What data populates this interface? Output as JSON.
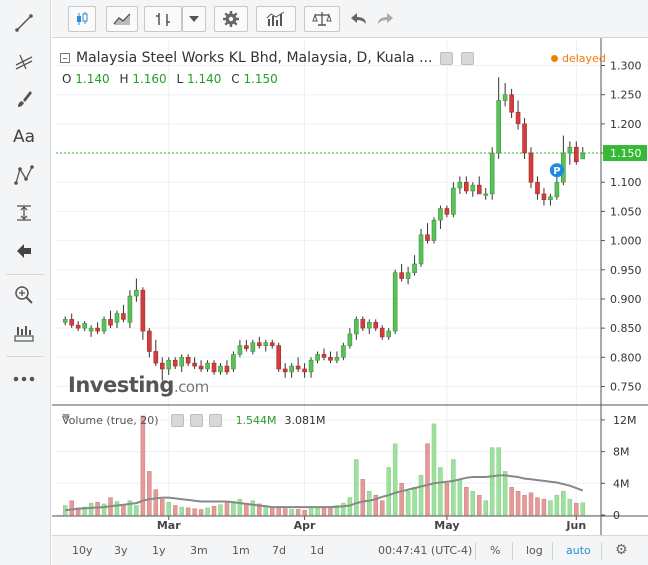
{
  "colors": {
    "up": "#5bbf5b",
    "down": "#d43d3d",
    "vol_up": "#9ee09e",
    "vol_down": "#e59a9a",
    "ma": "#888888",
    "lastline": "#2fb82f",
    "accent": "#2a8fd8"
  },
  "toolbar": {
    "icons": [
      "candlestick-icon",
      "area-chart-icon",
      "bar-chart-icon",
      "dropdown-icon",
      "gear-icon",
      "indicators-icon",
      "compare-scale-icon",
      "undo-icon",
      "redo-icon"
    ]
  },
  "left_tools": [
    "line-tool-icon",
    "fib-tool-icon",
    "brush-icon",
    "text-tool-icon",
    "pattern-tool-icon",
    "measure-icon",
    "back-arrow-icon",
    "zoom-icon",
    "ruler-icon",
    "more-icon"
  ],
  "left_text_label": "Aa",
  "legend": {
    "title": "Malaysia Steel Works KL Bhd, Malaysia, D, Kuala ...",
    "delayed": "delayed",
    "o_label": "O",
    "o": "1.140",
    "h_label": "H",
    "h": "1.160",
    "l_label": "L",
    "l": "1.140",
    "c_label": "C",
    "c": "1.150"
  },
  "volume_legend": {
    "label": "Volume (true, 20)",
    "v1": "1.544M",
    "v2": "3.081M"
  },
  "logo": {
    "main": "Investing",
    "suffix": ".com"
  },
  "price_axis_ticks": [
    "1.300",
    "1.250",
    "1.200",
    "1.150",
    "1.100",
    "1.050",
    "1.000",
    "0.950",
    "0.900",
    "0.850",
    "0.800",
    "0.750"
  ],
  "last_price": "1.150",
  "marker_label": "P",
  "volume_axis_ticks": [
    "12M",
    "8M",
    "4M",
    "0"
  ],
  "x_labels": [
    "Mar",
    "Apr",
    "May",
    "Jun"
  ],
  "bottombar": {
    "ranges": [
      "10y",
      "3y",
      "1y",
      "3m",
      "1m",
      "7d",
      "1d"
    ],
    "time": "00:47:41 (UTC-4)",
    "pct": "%",
    "log": "log",
    "auto": "auto"
  },
  "chart_data": {
    "type": "candlestick",
    "title": "Malaysia Steel Works KL Bhd, Malaysia, D, Kuala ...",
    "price_range": [
      0.72,
      1.33
    ],
    "volume_range": [
      0,
      13000000
    ],
    "x_ticks": [
      {
        "label": "Mar",
        "index": 16
      },
      {
        "label": "Apr",
        "index": 37
      },
      {
        "label": "May",
        "index": 59
      },
      {
        "label": "Jun",
        "index": 79
      }
    ],
    "candles": [
      {
        "o": 0.86,
        "h": 0.87,
        "l": 0.855,
        "c": 0.865,
        "v": 1200000
      },
      {
        "o": 0.865,
        "h": 0.875,
        "l": 0.85,
        "c": 0.855,
        "v": 1800000
      },
      {
        "o": 0.855,
        "h": 0.862,
        "l": 0.845,
        "c": 0.85,
        "v": 900000
      },
      {
        "o": 0.85,
        "h": 0.862,
        "l": 0.845,
        "c": 0.858,
        "v": 1000000
      },
      {
        "o": 0.845,
        "h": 0.855,
        "l": 0.835,
        "c": 0.85,
        "v": 1500000
      },
      {
        "o": 0.85,
        "h": 0.86,
        "l": 0.84,
        "c": 0.845,
        "v": 1600000
      },
      {
        "o": 0.845,
        "h": 0.87,
        "l": 0.84,
        "c": 0.865,
        "v": 1400000
      },
      {
        "o": 0.865,
        "h": 0.88,
        "l": 0.85,
        "c": 0.855,
        "v": 2200000
      },
      {
        "o": 0.86,
        "h": 0.88,
        "l": 0.85,
        "c": 0.875,
        "v": 1700000
      },
      {
        "o": 0.875,
        "h": 0.89,
        "l": 0.86,
        "c": 0.865,
        "v": 1300000
      },
      {
        "o": 0.86,
        "h": 0.915,
        "l": 0.85,
        "c": 0.905,
        "v": 1800000
      },
      {
        "o": 0.905,
        "h": 0.935,
        "l": 0.895,
        "c": 0.915,
        "v": 1200000
      },
      {
        "o": 0.915,
        "h": 0.92,
        "l": 0.83,
        "c": 0.845,
        "v": 12500000
      },
      {
        "o": 0.845,
        "h": 0.85,
        "l": 0.8,
        "c": 0.81,
        "v": 5500000
      },
      {
        "o": 0.81,
        "h": 0.83,
        "l": 0.785,
        "c": 0.79,
        "v": 3200000
      },
      {
        "o": 0.79,
        "h": 0.8,
        "l": 0.76,
        "c": 0.78,
        "v": 2000000
      },
      {
        "o": 0.78,
        "h": 0.8,
        "l": 0.77,
        "c": 0.795,
        "v": 1600000
      },
      {
        "o": 0.795,
        "h": 0.8,
        "l": 0.78,
        "c": 0.785,
        "v": 1200000
      },
      {
        "o": 0.785,
        "h": 0.805,
        "l": 0.775,
        "c": 0.8,
        "v": 1000000
      },
      {
        "o": 0.8,
        "h": 0.805,
        "l": 0.785,
        "c": 0.79,
        "v": 900000
      },
      {
        "o": 0.79,
        "h": 0.8,
        "l": 0.78,
        "c": 0.785,
        "v": 800000
      },
      {
        "o": 0.785,
        "h": 0.795,
        "l": 0.775,
        "c": 0.78,
        "v": 700000
      },
      {
        "o": 0.78,
        "h": 0.795,
        "l": 0.775,
        "c": 0.79,
        "v": 900000
      },
      {
        "o": 0.79,
        "h": 0.795,
        "l": 0.77,
        "c": 0.775,
        "v": 1100000
      },
      {
        "o": 0.775,
        "h": 0.79,
        "l": 0.77,
        "c": 0.785,
        "v": 1300000
      },
      {
        "o": 0.785,
        "h": 0.795,
        "l": 0.77,
        "c": 0.775,
        "v": 1600000
      },
      {
        "o": 0.78,
        "h": 0.81,
        "l": 0.775,
        "c": 0.805,
        "v": 1700000
      },
      {
        "o": 0.805,
        "h": 0.83,
        "l": 0.8,
        "c": 0.82,
        "v": 2000000
      },
      {
        "o": 0.82,
        "h": 0.83,
        "l": 0.81,
        "c": 0.815,
        "v": 1500000
      },
      {
        "o": 0.81,
        "h": 0.83,
        "l": 0.805,
        "c": 0.825,
        "v": 1800000
      },
      {
        "o": 0.825,
        "h": 0.835,
        "l": 0.815,
        "c": 0.82,
        "v": 1400000
      },
      {
        "o": 0.82,
        "h": 0.83,
        "l": 0.81,
        "c": 0.825,
        "v": 1200000
      },
      {
        "o": 0.825,
        "h": 0.83,
        "l": 0.815,
        "c": 0.82,
        "v": 1000000
      },
      {
        "o": 0.82,
        "h": 0.825,
        "l": 0.775,
        "c": 0.78,
        "v": 900000
      },
      {
        "o": 0.78,
        "h": 0.79,
        "l": 0.765,
        "c": 0.775,
        "v": 800000
      },
      {
        "o": 0.775,
        "h": 0.79,
        "l": 0.765,
        "c": 0.785,
        "v": 700000
      },
      {
        "o": 0.785,
        "h": 0.8,
        "l": 0.775,
        "c": 0.78,
        "v": 700000
      },
      {
        "o": 0.78,
        "h": 0.79,
        "l": 0.765,
        "c": 0.775,
        "v": 600000
      },
      {
        "o": 0.775,
        "h": 0.8,
        "l": 0.765,
        "c": 0.795,
        "v": 800000
      },
      {
        "o": 0.795,
        "h": 0.81,
        "l": 0.79,
        "c": 0.805,
        "v": 900000
      },
      {
        "o": 0.805,
        "h": 0.815,
        "l": 0.795,
        "c": 0.8,
        "v": 1000000
      },
      {
        "o": 0.8,
        "h": 0.81,
        "l": 0.79,
        "c": 0.795,
        "v": 1100000
      },
      {
        "o": 0.795,
        "h": 0.81,
        "l": 0.79,
        "c": 0.8,
        "v": 1200000
      },
      {
        "o": 0.8,
        "h": 0.825,
        "l": 0.795,
        "c": 0.82,
        "v": 1500000
      },
      {
        "o": 0.82,
        "h": 0.85,
        "l": 0.815,
        "c": 0.84,
        "v": 2200000
      },
      {
        "o": 0.84,
        "h": 0.87,
        "l": 0.83,
        "c": 0.865,
        "v": 7000000
      },
      {
        "o": 0.865,
        "h": 0.87,
        "l": 0.845,
        "c": 0.85,
        "v": 4500000
      },
      {
        "o": 0.85,
        "h": 0.865,
        "l": 0.84,
        "c": 0.86,
        "v": 3000000
      },
      {
        "o": 0.86,
        "h": 0.865,
        "l": 0.845,
        "c": 0.85,
        "v": 2500000
      },
      {
        "o": 0.85,
        "h": 0.855,
        "l": 0.83,
        "c": 0.835,
        "v": 1800000
      },
      {
        "o": 0.835,
        "h": 0.85,
        "l": 0.83,
        "c": 0.845,
        "v": 6000000
      },
      {
        "o": 0.845,
        "h": 0.95,
        "l": 0.84,
        "c": 0.945,
        "v": 9000000
      },
      {
        "o": 0.945,
        "h": 0.96,
        "l": 0.93,
        "c": 0.935,
        "v": 4000000
      },
      {
        "o": 0.935,
        "h": 0.955,
        "l": 0.925,
        "c": 0.945,
        "v": 3000000
      },
      {
        "o": 0.945,
        "h": 0.975,
        "l": 0.94,
        "c": 0.96,
        "v": 3500000
      },
      {
        "o": 0.96,
        "h": 1.02,
        "l": 0.955,
        "c": 1.01,
        "v": 5000000
      },
      {
        "o": 1.01,
        "h": 1.03,
        "l": 0.995,
        "c": 1.0,
        "v": 9000000
      },
      {
        "o": 1.0,
        "h": 1.04,
        "l": 0.995,
        "c": 1.035,
        "v": 11500000
      },
      {
        "o": 1.035,
        "h": 1.06,
        "l": 1.02,
        "c": 1.055,
        "v": 6000000
      },
      {
        "o": 1.055,
        "h": 1.06,
        "l": 1.04,
        "c": 1.045,
        "v": 4000000
      },
      {
        "o": 1.045,
        "h": 1.1,
        "l": 1.04,
        "c": 1.09,
        "v": 7000000
      },
      {
        "o": 1.09,
        "h": 1.11,
        "l": 1.08,
        "c": 1.1,
        "v": 4500000
      },
      {
        "o": 1.1,
        "h": 1.11,
        "l": 1.08,
        "c": 1.085,
        "v": 3500000
      },
      {
        "o": 1.085,
        "h": 1.1,
        "l": 1.075,
        "c": 1.095,
        "v": 3000000
      },
      {
        "o": 1.095,
        "h": 1.11,
        "l": 1.08,
        "c": 1.08,
        "v": 2500000
      },
      {
        "o": 1.08,
        "h": 1.09,
        "l": 1.07,
        "c": 1.08,
        "v": 1800000
      },
      {
        "o": 1.08,
        "h": 1.16,
        "l": 1.07,
        "c": 1.15,
        "v": 8500000
      },
      {
        "o": 1.15,
        "h": 1.28,
        "l": 1.14,
        "c": 1.24,
        "v": 8500000
      },
      {
        "o": 1.24,
        "h": 1.27,
        "l": 1.23,
        "c": 1.25,
        "v": 5500000
      },
      {
        "o": 1.25,
        "h": 1.26,
        "l": 1.21,
        "c": 1.22,
        "v": 3500000
      },
      {
        "o": 1.22,
        "h": 1.24,
        "l": 1.19,
        "c": 1.2,
        "v": 3000000
      },
      {
        "o": 1.2,
        "h": 1.21,
        "l": 1.14,
        "c": 1.15,
        "v": 2500000
      },
      {
        "o": 1.15,
        "h": 1.16,
        "l": 1.09,
        "c": 1.1,
        "v": 2800000
      },
      {
        "o": 1.1,
        "h": 1.11,
        "l": 1.07,
        "c": 1.08,
        "v": 2200000
      },
      {
        "o": 1.08,
        "h": 1.09,
        "l": 1.06,
        "c": 1.07,
        "v": 2000000
      },
      {
        "o": 1.07,
        "h": 1.08,
        "l": 1.06,
        "c": 1.075,
        "v": 1800000
      },
      {
        "o": 1.075,
        "h": 1.11,
        "l": 1.07,
        "c": 1.1,
        "v": 2500000
      },
      {
        "o": 1.1,
        "h": 1.18,
        "l": 1.095,
        "c": 1.15,
        "v": 3000000
      },
      {
        "o": 1.15,
        "h": 1.17,
        "l": 1.13,
        "c": 1.16,
        "v": 2000000
      },
      {
        "o": 1.16,
        "h": 1.17,
        "l": 1.13,
        "c": 1.135,
        "v": 1500000
      },
      {
        "o": 1.14,
        "h": 1.16,
        "l": 1.14,
        "c": 1.15,
        "v": 1544000
      }
    ],
    "ma_line": [
      600000,
      700000,
      800000,
      850000,
      900000,
      950000,
      1000000,
      1100000,
      1200000,
      1300000,
      1400000,
      1500000,
      1800000,
      2000000,
      2100000,
      2200000,
      2200000,
      2100000,
      2000000,
      1900000,
      1800000,
      1700000,
      1700000,
      1700000,
      1700000,
      1700000,
      1600000,
      1500000,
      1400000,
      1300000,
      1200000,
      1100000,
      1000000,
      1000000,
      1000000,
      1000000,
      1000000,
      1000000,
      1000000,
      1000000,
      1000000,
      1000000,
      1050000,
      1100000,
      1200000,
      1500000,
      1700000,
      1800000,
      2000000,
      2300000,
      2500000,
      2800000,
      3000000,
      3200000,
      3400000,
      3600000,
      3800000,
      4000000,
      4100000,
      4200000,
      4300000,
      4500000,
      4700000,
      4800000,
      4800000,
      4800000,
      4900000,
      5000000,
      5000000,
      4900000,
      4800000,
      4600000,
      4500000,
      4400000,
      4300000,
      4200000,
      4100000,
      3900000,
      3700000,
      3400000,
      3081000
    ]
  }
}
